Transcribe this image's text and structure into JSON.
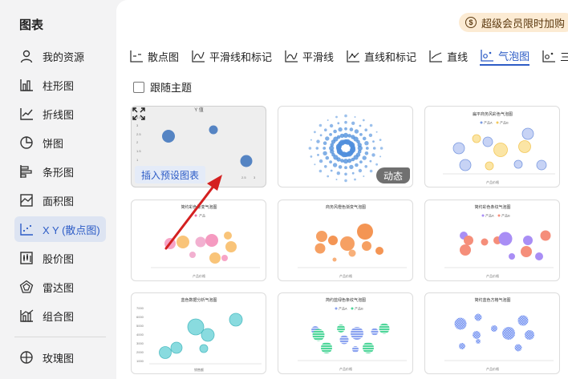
{
  "sidebar": {
    "title": "图表",
    "items": [
      {
        "label": "我的资源",
        "icon": "user-icon"
      },
      {
        "label": "柱形图",
        "icon": "column-chart-icon"
      },
      {
        "label": "折线图",
        "icon": "line-chart-icon"
      },
      {
        "label": "饼图",
        "icon": "pie-chart-icon"
      },
      {
        "label": "条形图",
        "icon": "bar-chart-icon"
      },
      {
        "label": "面积图",
        "icon": "area-chart-icon"
      },
      {
        "label": "X Y (散点图)",
        "icon": "scatter-chart-icon",
        "active": true
      },
      {
        "label": "股价图",
        "icon": "stock-chart-icon"
      },
      {
        "label": "雷达图",
        "icon": "radar-chart-icon"
      },
      {
        "label": "组合图",
        "icon": "combo-chart-icon"
      },
      {
        "label": "玫瑰图",
        "icon": "rose-chart-icon"
      }
    ]
  },
  "promo": {
    "label": "超级会员限时加购",
    "icon": "coin-icon"
  },
  "tabs": [
    {
      "label": "散点图",
      "icon": "scatter-icon"
    },
    {
      "label": "平滑线和标记",
      "icon": "smooth-marker-icon"
    },
    {
      "label": "平滑线",
      "icon": "smooth-line-icon"
    },
    {
      "label": "直线和标记",
      "icon": "straight-marker-icon"
    },
    {
      "label": "直线",
      "icon": "straight-line-icon"
    },
    {
      "label": "气泡图",
      "icon": "bubble-icon",
      "active": true
    },
    {
      "label": "三维",
      "icon": "bubble-3d-icon"
    }
  ],
  "follow_theme": {
    "label": "跟随主题",
    "checked": false
  },
  "cards": [
    {
      "title": "Y 值",
      "insert_label": "插入预设图表",
      "hovered": true
    },
    {
      "title": "",
      "badge": "动态"
    },
    {
      "title": "扁平商务风彩色气泡图",
      "legend": [
        "产品A",
        "产品B"
      ],
      "xlabel": "产品价格"
    },
    {
      "title": "简约彩色渐变气泡图",
      "legend": [
        "产品"
      ],
      "xlabel": "产品价格"
    },
    {
      "title": "商务风橙色渐变气泡图",
      "xlabel": "产品价格"
    },
    {
      "title": "简约彩色条纹气泡图",
      "legend": [
        "产品A",
        "产品B"
      ],
      "xlabel": "产品价格"
    },
    {
      "title": "蓝色数据分析气泡图",
      "xlabel": "销售额"
    },
    {
      "title": "简约蓝绿色条纹气泡图",
      "legend": [
        "产品A",
        "产品B"
      ],
      "xlabel": "产品价格"
    },
    {
      "title": "简约蓝色方格气泡图",
      "xlabel": "产品价格"
    }
  ],
  "colors": {
    "accent": "#2d5cc6",
    "arrow": "#d42020",
    "promo_bg": "#fcebd3"
  }
}
